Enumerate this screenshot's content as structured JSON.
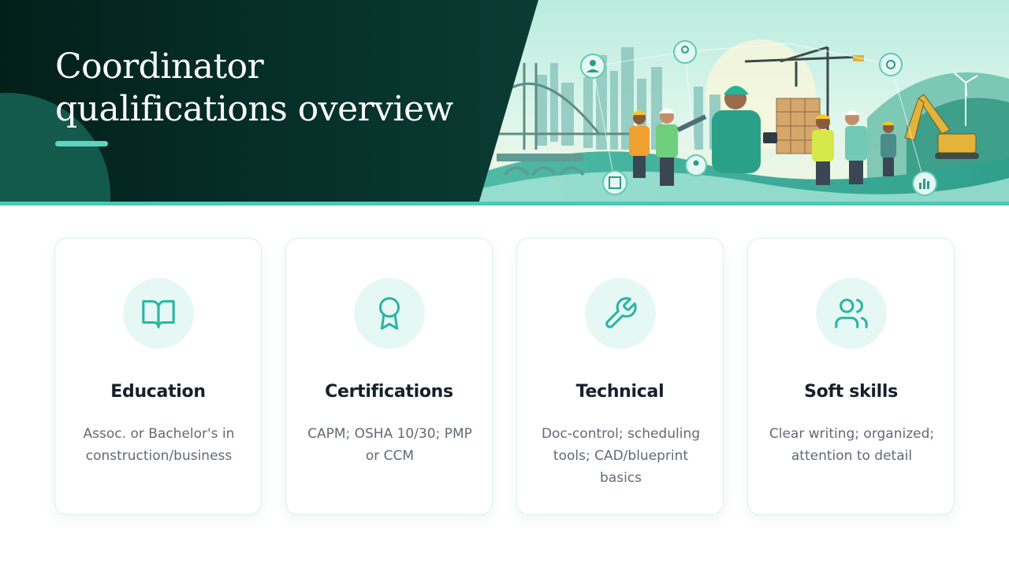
{
  "header": {
    "title": "Coordinator qualifications overview",
    "colors": {
      "dark": "#031f1a",
      "accent": "#4cc9b6",
      "underline": "#5ed3c0"
    }
  },
  "cards": [
    {
      "icon": "book-open-icon",
      "title": "Education",
      "text": "Assoc. or Bachelor's in construction/business"
    },
    {
      "icon": "award-icon",
      "title": "Certifications",
      "text": "CAPM; OSHA 10/30; PMP or CCM"
    },
    {
      "icon": "wrench-icon",
      "title": "Technical",
      "text": "Doc-control; scheduling tools; CAD/blueprint basics"
    },
    {
      "icon": "users-icon",
      "title": "Soft skills",
      "text": "Clear writing; organized; attention to detail"
    }
  ],
  "theme": {
    "icon_stroke": "#2bb5a3",
    "icon_bg": "#e6f8f4",
    "card_border": "#d7f1ec"
  }
}
